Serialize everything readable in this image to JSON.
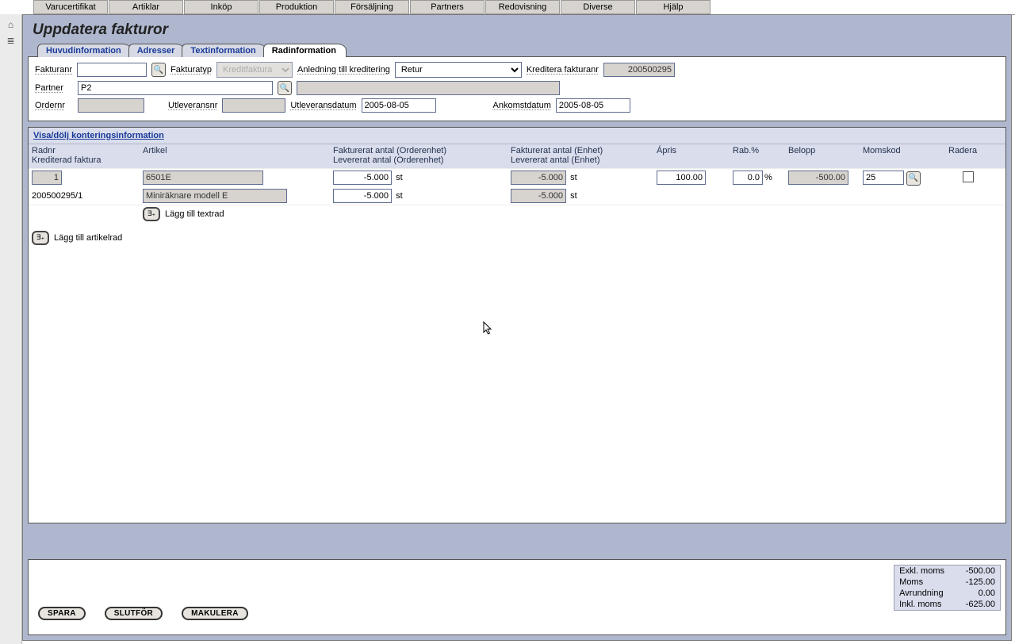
{
  "topmenu": [
    "Varucertifikat",
    "Artiklar",
    "Inköp",
    "Produktion",
    "Försäljning",
    "Partners",
    "Redovisning",
    "Diverse",
    "Hjälp"
  ],
  "page_title": "Uppdatera fakturor",
  "tabs": {
    "t0": "Huvudinformation",
    "t1": "Adresser",
    "t2": "Textinformation",
    "t3": "Radinformation",
    "active": "t3"
  },
  "form": {
    "fakturanr_label": "Fakturanr",
    "fakturanr_value": "",
    "fakturatyp_label": "Fakturatyp",
    "fakturatyp_value": "Kreditfaktura",
    "anledning_label": "Anledning till kreditering",
    "anledning_value": "Retur",
    "kreditera_label": "Kreditera fakturanr",
    "kreditera_value": "200500295",
    "partner_label": "Partner",
    "partner_value": "P2",
    "partner_desc": "",
    "ordernr_label": "Ordernr",
    "ordernr_value": "",
    "utleveransnr_label": "Utleveransnr",
    "utleveransnr_value": "",
    "utleveransdatum_label": "Utleveransdatum",
    "utleveransdatum_value": "2005-08-05",
    "ankomstdatum_label": "Ankomstdatum",
    "ankomstdatum_value": "2005-08-05"
  },
  "grid": {
    "section_link": "Visa/dölj konteringsinformation",
    "cols": {
      "radnr_l1": "Radnr",
      "radnr_l2": "Krediterad faktura",
      "artikel": "Artikel",
      "fakt_order_l1": "Fakturerat antal (Orderenhet)",
      "fakt_order_l2": "Levererat antal (Orderenhet)",
      "fakt_enhet_l1": "Fakturerat antal (Enhet)",
      "fakt_enhet_l2": "Levererat antal (Enhet)",
      "apris": "Ápris",
      "rab": "Rab.%",
      "belopp": "Belopp",
      "momskod": "Momskod",
      "radera": "Radera"
    },
    "row": {
      "radnr": "1",
      "krediterad": "200500295/1",
      "artikel_code": "6501E",
      "artikel_name": "Miniräknare modell E",
      "fakt_order_qty": "-5.000",
      "lev_order_qty": "-5.000",
      "fakt_enhet_qty": "-5.000",
      "lev_enhet_qty": "-5.000",
      "unit": "st",
      "apris": "100.00",
      "rab": "0.0",
      "rab_unit": "%",
      "belopp": "-500.00",
      "momskod": "25"
    },
    "add_textrow": "Lägg till textrad",
    "add_articlerow": "Lägg till artikelrad"
  },
  "footer": {
    "spara": "SPARA",
    "slutfor": "SLUTFÖR",
    "makulera": "MAKULERA",
    "totals": {
      "exkl_label": "Exkl. moms",
      "exkl_value": "-500.00",
      "moms_label": "Moms",
      "moms_value": "-125.00",
      "avr_label": "Avrundning",
      "avr_value": "0.00",
      "inkl_label": "Inkl. moms",
      "inkl_value": "-625.00"
    }
  }
}
